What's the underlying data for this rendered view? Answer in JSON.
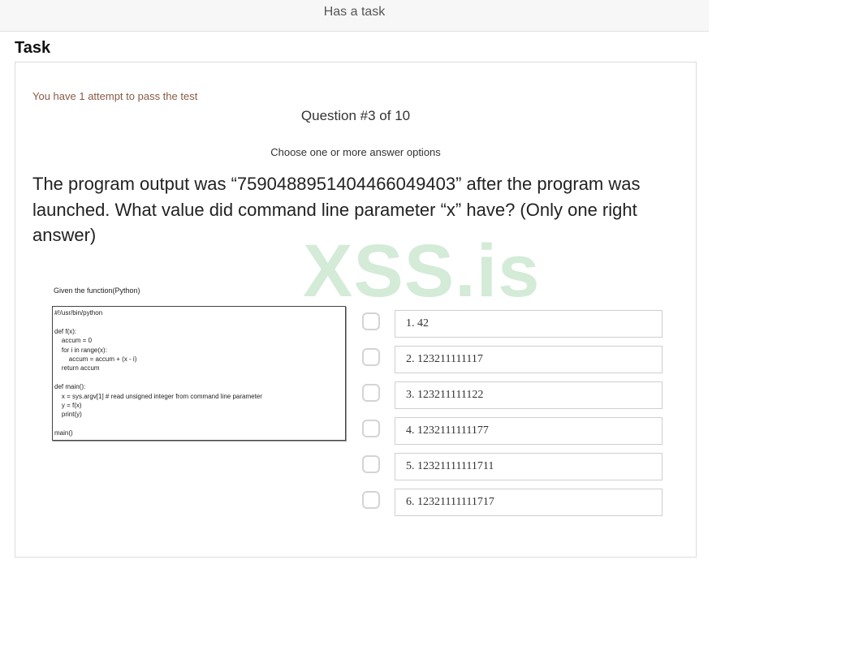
{
  "header": {
    "title": "Has a task"
  },
  "section": {
    "title": "Task"
  },
  "quiz": {
    "attempts": "You have 1 attempt to pass the test",
    "counter": "Question #3 of 10",
    "instructions": "Choose one or more answer options",
    "question": "The program output was “7590488951404466049403” after the program was launched. What value did command line parameter “x” have? (Only one right answer)",
    "watermark": "XSS.is",
    "image": {
      "label": "Given the function(Python)",
      "code": [
        "#!/usr/bin/python",
        "",
        "def f(x):",
        "    accum = 0",
        "    for i in range(x):",
        "        accum = accum + (x - i)",
        "    return accum",
        "",
        "def main():",
        "    x = sys.argv[1] # read unsigned integer from command line parameter",
        "    y = f(x)",
        "    print(y)",
        "",
        "main()"
      ]
    },
    "options": [
      {
        "label": "1. 42",
        "checked": false
      },
      {
        "label": "2. 123211111117",
        "checked": false
      },
      {
        "label": "3. 123211111122",
        "checked": false
      },
      {
        "label": "4. 1232111111177",
        "checked": false
      },
      {
        "label": "5. 12321111111711",
        "checked": false
      },
      {
        "label": "6. 12321111111717",
        "checked": false
      }
    ]
  }
}
